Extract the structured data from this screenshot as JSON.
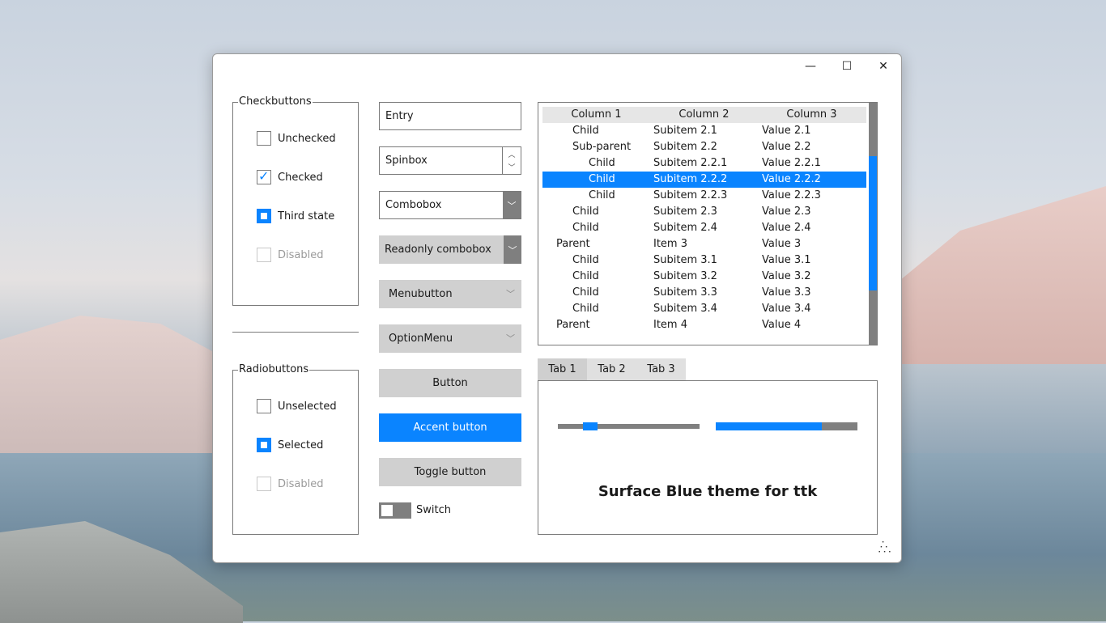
{
  "window": {
    "controls": {
      "minimize": "—",
      "maximize": "☐",
      "close": "✕"
    }
  },
  "checkbuttons": {
    "title": "Checkbuttons",
    "items": [
      {
        "label": "Unchecked",
        "state": "unchecked"
      },
      {
        "label": "Checked",
        "state": "checked"
      },
      {
        "label": "Third state",
        "state": "indeterminate"
      },
      {
        "label": "Disabled",
        "state": "disabled"
      }
    ]
  },
  "radiobuttons": {
    "title": "Radiobuttons",
    "items": [
      {
        "label": "Unselected",
        "state": "unselected"
      },
      {
        "label": "Selected",
        "state": "selected"
      },
      {
        "label": "Disabled",
        "state": "disabled"
      }
    ]
  },
  "inputs": {
    "entry": "Entry",
    "spinbox": "Spinbox",
    "combobox": "Combobox",
    "readonly_combobox": "Readonly combobox",
    "menubutton": "Menubutton",
    "optionmenu": "OptionMenu",
    "button": "Button",
    "accent_button": "Accent button",
    "toggle_button": "Toggle button",
    "switch": "Switch"
  },
  "tree": {
    "columns": [
      "Column 1",
      "Column 2",
      "Column 3"
    ],
    "rows": [
      {
        "c0": "Child",
        "c1": "Subitem 2.1",
        "c2": "Value 2.1",
        "level": 1
      },
      {
        "c0": "Sub-parent",
        "c1": "Subitem 2.2",
        "c2": "Value 2.2",
        "level": 1
      },
      {
        "c0": "Child",
        "c1": "Subitem 2.2.1",
        "c2": "Value 2.2.1",
        "level": 2
      },
      {
        "c0": "Child",
        "c1": "Subitem 2.2.2",
        "c2": "Value 2.2.2",
        "level": 2,
        "selected": true
      },
      {
        "c0": "Child",
        "c1": "Subitem 2.2.3",
        "c2": "Value 2.2.3",
        "level": 2
      },
      {
        "c0": "Child",
        "c1": "Subitem 2.3",
        "c2": "Value 2.3",
        "level": 1
      },
      {
        "c0": "Child",
        "c1": "Subitem 2.4",
        "c2": "Value 2.4",
        "level": 1
      },
      {
        "c0": "Parent",
        "c1": "Item 3",
        "c2": "Value 3",
        "level": 0
      },
      {
        "c0": "Child",
        "c1": "Subitem 3.1",
        "c2": "Value 3.1",
        "level": 1
      },
      {
        "c0": "Child",
        "c1": "Subitem 3.2",
        "c2": "Value 3.2",
        "level": 1
      },
      {
        "c0": "Child",
        "c1": "Subitem 3.3",
        "c2": "Value 3.3",
        "level": 1
      },
      {
        "c0": "Child",
        "c1": "Subitem 3.4",
        "c2": "Value 3.4",
        "level": 1
      },
      {
        "c0": "Parent",
        "c1": "Item 4",
        "c2": "Value 4",
        "level": 0
      }
    ]
  },
  "notebook": {
    "tabs": [
      "Tab 1",
      "Tab 2",
      "Tab 3"
    ],
    "active_tab": 0,
    "scale_value": 0.2,
    "progress_value": 0.75,
    "label": "Surface Blue theme for ttk"
  },
  "colors": {
    "accent": "#0a84ff",
    "neutral": "#808080"
  }
}
